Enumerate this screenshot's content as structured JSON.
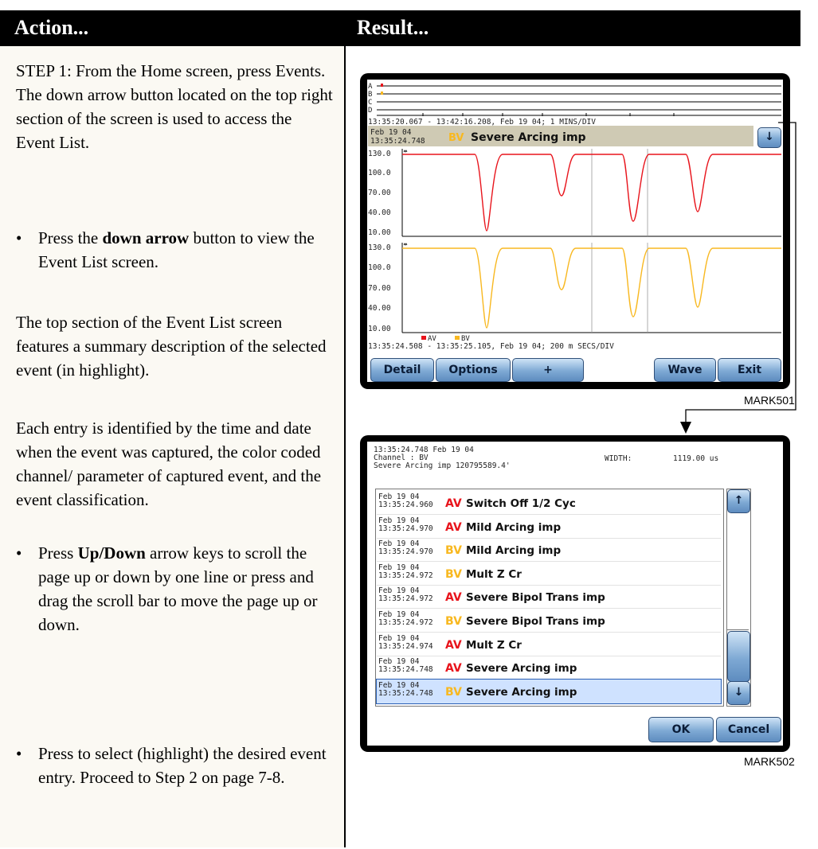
{
  "header": {
    "action": "Action...",
    "result": "Result..."
  },
  "left": {
    "step1": "STEP 1: From the Home screen, press Events. The down arrow button located on the top right section of the screen is used to access the Event List.",
    "bullet1_pre": "Press the ",
    "bullet1_bold": "down arrow",
    "bullet1_post": " button to view the Event List screen.",
    "para2": "The top section of the Event List screen features a summary description of the selected event (in highlight).",
    "para3": "Each entry is identified by the time and date when the event was captured, the color coded channel/ parameter of captured event, and the event classification.",
    "bullet2_pre": "Press ",
    "bullet2_bold": "Up/Down",
    "bullet2_post": " arrow keys to scroll the page up or down by one line or press and drag the scroll bar to move the page up or down.",
    "bullet3": "Press to select (highlight) the desired event entry. Proceed to Step 2 on page 7-8."
  },
  "screen1": {
    "channels": [
      "A",
      "B",
      "C",
      "D"
    ],
    "range_top": "13:35:20.067 - 13:42:16.208, Feb 19 04;   1 MINS/DIV",
    "sel_date": "Feb 19 04",
    "sel_time": "13:35:24.748",
    "sel_channel": "BV",
    "sel_class": "Severe Arcing imp",
    "yticks": [
      "130.0",
      "100.0",
      "70.00",
      "40.00",
      "10.00"
    ],
    "legend_a": "AV",
    "legend_b": "BV",
    "range_bottom": "13:35:24.508 - 13:35:25.105, Feb 19 04;    200 m SECS/DIV",
    "buttons": [
      "Detail",
      "Options",
      "+",
      "Wave",
      "Exit"
    ],
    "mark": "MARK501",
    "colors": {
      "av": "#e8141c",
      "bv": "#f8b820"
    }
  },
  "screen2": {
    "sum_time_date": "13:35:24.748  Feb 19 04",
    "sum_channel": "Channel :      BV",
    "sum_event": "Severe Arcing imp  120795589.4'",
    "width_label": "WIDTH:",
    "width_value": "1119.00  us",
    "rows": [
      {
        "date": "Feb 19 04",
        "time": "13:35:24.960",
        "ch": "AV",
        "cls": "Switch Off 1/2 Cyc"
      },
      {
        "date": "Feb 19 04",
        "time": "13:35:24.970",
        "ch": "AV",
        "cls": "Mild Arcing imp"
      },
      {
        "date": "Feb 19 04",
        "time": "13:35:24.970",
        "ch": "BV",
        "cls": "Mild Arcing imp"
      },
      {
        "date": "Feb 19 04",
        "time": "13:35:24.972",
        "ch": "BV",
        "cls": "Mult Z Cr"
      },
      {
        "date": "Feb 19 04",
        "time": "13:35:24.972",
        "ch": "AV",
        "cls": "Severe Bipol Trans imp"
      },
      {
        "date": "Feb 19 04",
        "time": "13:35:24.972",
        "ch": "BV",
        "cls": "Severe Bipol Trans imp"
      },
      {
        "date": "Feb 19 04",
        "time": "13:35:24.974",
        "ch": "AV",
        "cls": "Mult Z Cr"
      },
      {
        "date": "Feb 19 04",
        "time": "13:35:24.748",
        "ch": "AV",
        "cls": "Severe Arcing imp"
      },
      {
        "date": "Feb 19 04",
        "time": "13:35:24.748",
        "ch": "BV",
        "cls": "Severe Arcing imp"
      }
    ],
    "selected_row": 8,
    "ok": "OK",
    "cancel": "Cancel",
    "mark": "MARK502"
  }
}
